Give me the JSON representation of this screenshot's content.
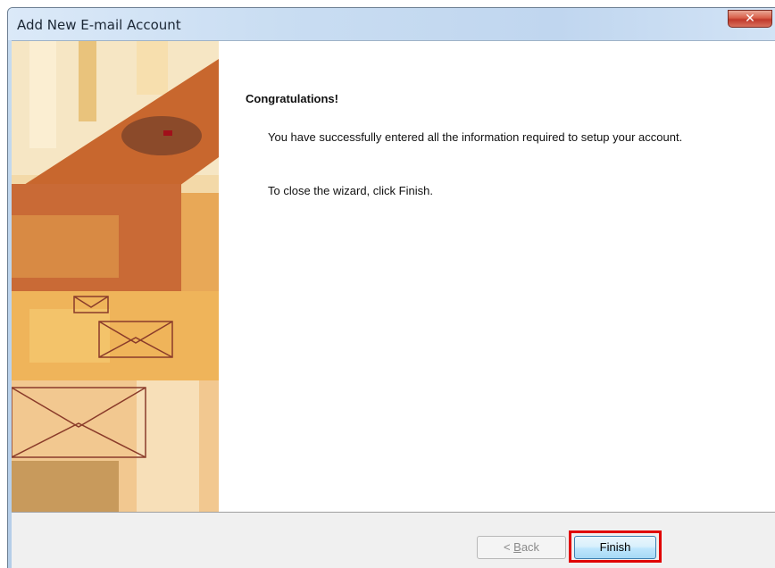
{
  "window": {
    "title": "Add New E-mail Account",
    "close_icon": "close-icon",
    "close_glyph": "✕"
  },
  "content": {
    "heading": "Congratulations!",
    "message": "You have successfully entered all the information required to setup your account.",
    "instruction": "To close the wizard, click Finish."
  },
  "buttons": {
    "back_prefix": "< ",
    "back_mnemonic": "B",
    "back_rest": "ack",
    "finish_label": "Finish"
  },
  "colors": {
    "highlight": "#e00000",
    "close_button": "#c0392b"
  }
}
